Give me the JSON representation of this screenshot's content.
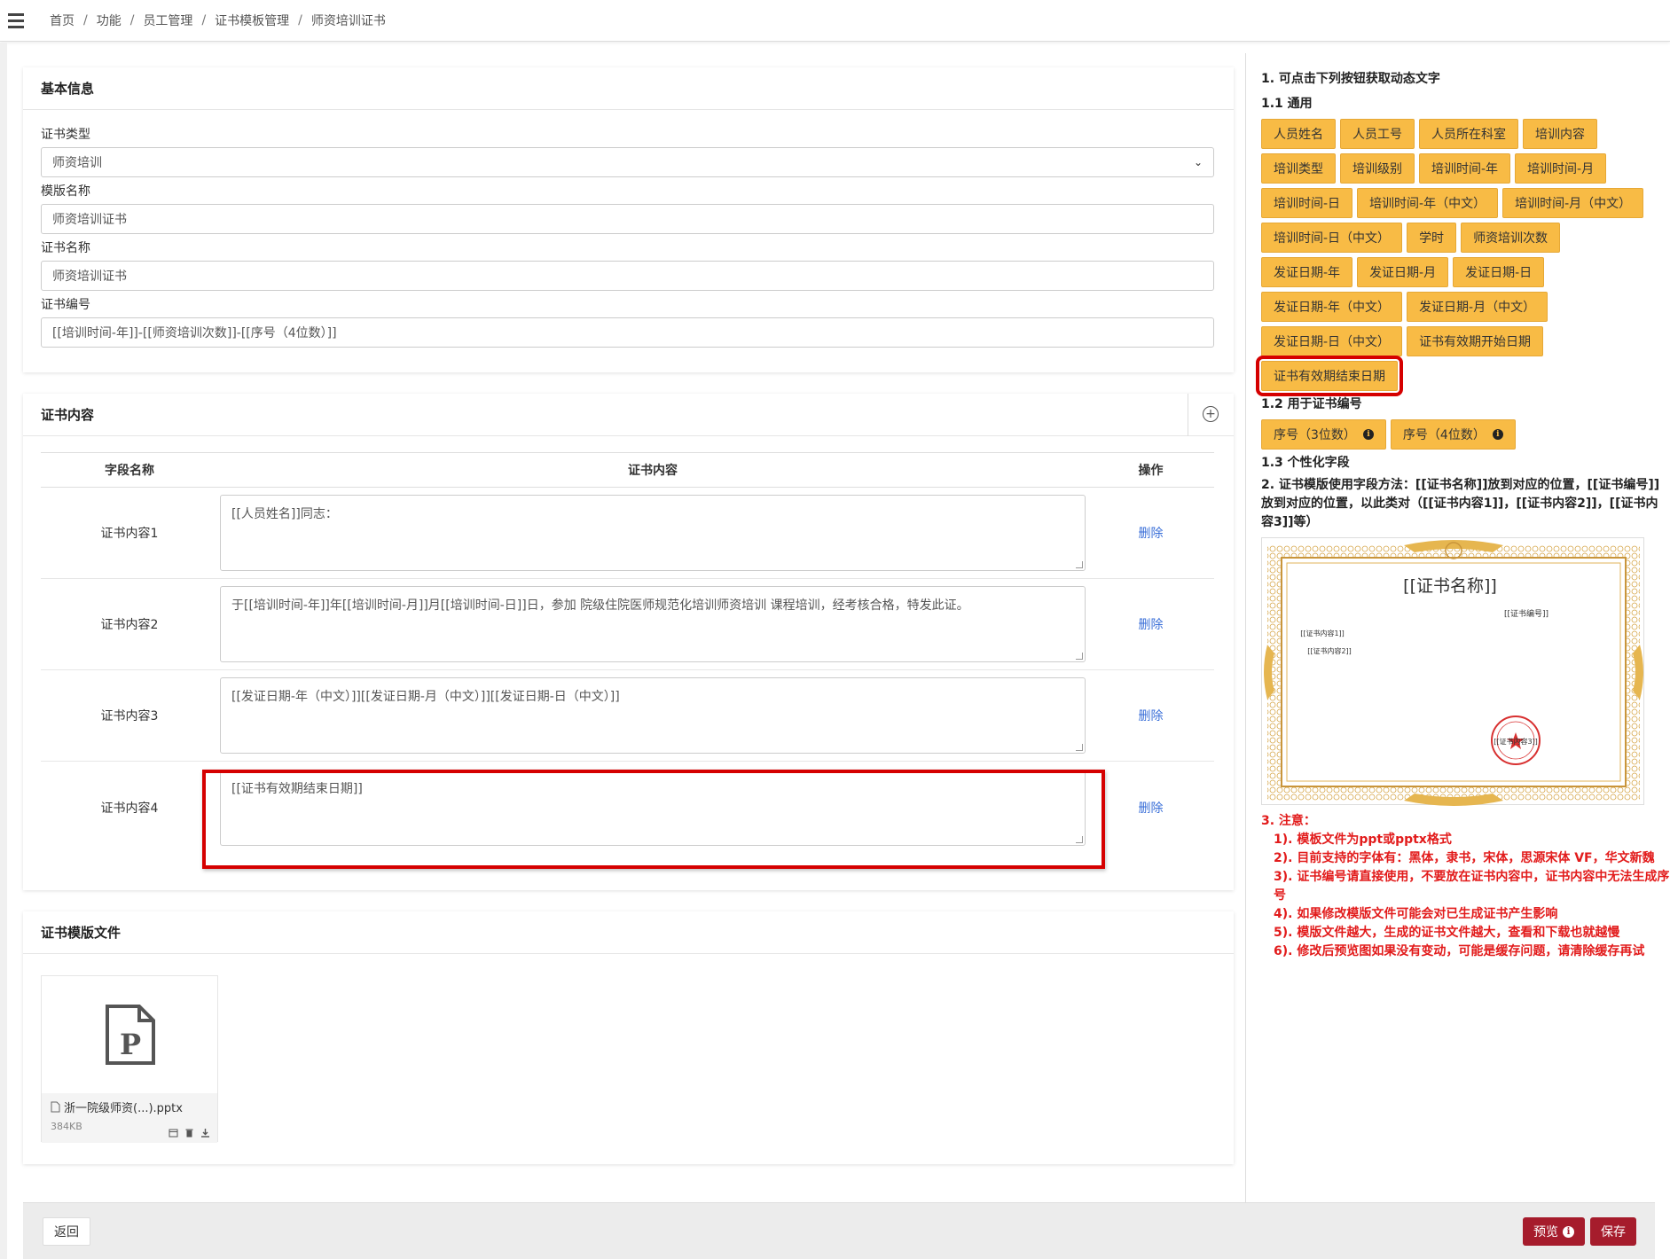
{
  "breadcrumb": {
    "items": [
      "首页",
      "功能",
      "员工管理",
      "证书模板管理"
    ],
    "current": "师资培训证书"
  },
  "basic_info": {
    "title": "基本信息",
    "cert_type_label": "证书类型",
    "cert_type_value": "师资培训",
    "template_name_label": "模版名称",
    "template_name_value": "师资培训证书",
    "cert_name_label": "证书名称",
    "cert_name_value": "师资培训证书",
    "cert_no_label": "证书编号",
    "cert_no_value": "[[培训时间-年]]-[[师资培训次数]]-[[序号（4位数）]]"
  },
  "cert_content": {
    "title": "证书内容",
    "col_name": "字段名称",
    "col_content": "证书内容",
    "col_op": "操作",
    "rows": [
      {
        "name": "证书内容1",
        "value": "[[人员姓名]]同志：",
        "op": "删除"
      },
      {
        "name": "证书内容2",
        "value": "于[[培训时间-年]]年[[培训时间-月]]月[[培训时间-日]]日，参加 院级住院医师规范化培训师资培训 课程培训，经考核合格，特发此证。",
        "op": "删除"
      },
      {
        "name": "证书内容3",
        "value": "[[发证日期-年（中文）]][[发证日期-月（中文）]][[发证日期-日（中文）]]",
        "op": "删除"
      },
      {
        "name": "证书内容4",
        "value": "[[证书有效期结束日期]]",
        "op": "删除"
      }
    ]
  },
  "template_file": {
    "title": "证书模版文件",
    "file_name": "浙一院级师资(...).pptx",
    "file_size": "384KB"
  },
  "footer": {
    "back": "返回",
    "preview": "预览",
    "save": "保存"
  },
  "right": {
    "h1": "1. 可点击下列按钮获取动态文字",
    "h11": "1.1 通用",
    "general_chips": [
      "人员姓名",
      "人员工号",
      "人员所在科室",
      "培训内容",
      "培训类型",
      "培训级别",
      "培训时间-年",
      "培训时间-月",
      "培训时间-日",
      "培训时间-年（中文）",
      "培训时间-月（中文）",
      "培训时间-日（中文）",
      "学时",
      "师资培训次数",
      "发证日期-年",
      "发证日期-月",
      "发证日期-日",
      "发证日期-年（中文）",
      "发证日期-月（中文）",
      "发证日期-日（中文）",
      "证书有效期开始日期",
      "证书有效期结束日期"
    ],
    "h12": "1.2 用于证书编号",
    "serial_chips": [
      "序号（3位数）",
      "序号（4位数）"
    ],
    "h13": "1.3 个性化字段",
    "usage": "2. 证书模版使用字段方法：[[证书名称]]放到对应的位置，[[证书编号]]放到对应的位置，以此类对（[[证书内容1]]，[[证书内容2]]，[[证书内容3]]等）",
    "preview_title": "[[证书名称]]",
    "preview_no": "[[证书编号]]",
    "preview_c1": "[[证书内容1]]",
    "preview_c2": "[[证书内容2]]",
    "preview_c3": "[[证书内容3]]",
    "notes_title": "3. 注意：",
    "notes": [
      "1). 模板文件为ppt或pptx格式",
      "2). 目前支持的字体有：黑体，隶书，宋体，思源宋体 VF，华文新魏",
      "3). 证书编号请直接使用，不要放在证书内容中，证书内容中无法生成序号",
      "4). 如果修改模版文件可能会对已生成证书产生影响",
      "5). 模版文件越大，生成的证书文件越大，查看和下载也就越慢",
      "6). 修改后预览图如果没有变动，可能是缓存问题，请清除缓存再试"
    ]
  },
  "colors": {
    "chip": "#f8bb45",
    "accent_red": "#a61c2c",
    "highlight": "#d50000",
    "note": "#e21b1b",
    "link": "#3a6fd8"
  }
}
